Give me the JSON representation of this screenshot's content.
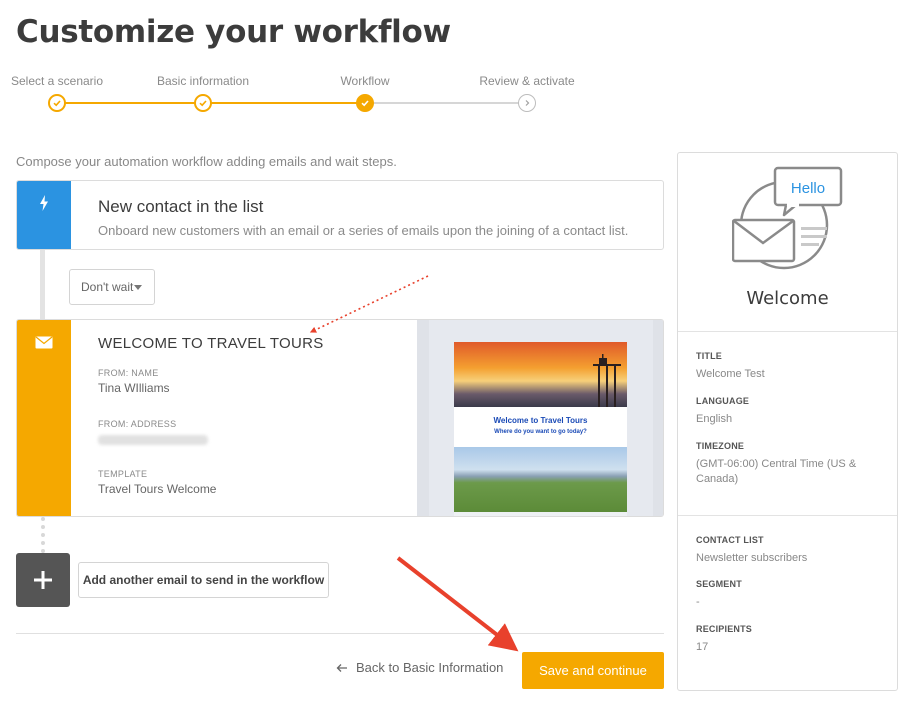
{
  "page": {
    "title": "Customize your workflow"
  },
  "stepper": {
    "steps": [
      {
        "label": "Select a scenario",
        "state": "done"
      },
      {
        "label": "Basic information",
        "state": "done"
      },
      {
        "label": "Workflow",
        "state": "current"
      },
      {
        "label": "Review & activate",
        "state": "todo"
      }
    ]
  },
  "intro": "Compose your automation workflow adding emails and wait steps.",
  "trigger": {
    "icon": "lightning-icon",
    "title": "New contact in the list",
    "description": "Onboard new customers with an email or a series of emails upon the joining of a contact list."
  },
  "wait": {
    "selected": "Don't wait"
  },
  "email": {
    "icon": "envelope-icon",
    "title": "WELCOME TO TRAVEL TOURS",
    "from_name_label": "FROM: NAME",
    "from_name": "Tina WIlliams",
    "from_address_label": "FROM: ADDRESS",
    "template_label": "TEMPLATE",
    "template": "Travel Tours Welcome",
    "preview": {
      "heading": "Welcome to Travel Tours",
      "subheading": "Where do you want to go today?"
    }
  },
  "add_email": {
    "label": "Add another email to send in the workflow"
  },
  "footer": {
    "back_label": "Back to Basic Information",
    "save_label": "Save and continue"
  },
  "panel": {
    "bubble": "Hello",
    "title": "Welcome",
    "title_label": "TITLE",
    "title_value": "Welcome Test",
    "language_label": "LANGUAGE",
    "language_value": "English",
    "timezone_label": "TIMEZONE",
    "timezone_value": "(GMT-06:00) Central Time (US & Canada)",
    "contact_list_label": "CONTACT LIST",
    "contact_list_value": "Newsletter subscribers",
    "segment_label": "SEGMENT",
    "segment_value": "-",
    "recipients_label": "RECIPIENTS",
    "recipients_value": "17"
  },
  "colors": {
    "accent": "#f5a800",
    "trigger": "#2b93e1",
    "annotation_arrow": "#e8412c"
  }
}
